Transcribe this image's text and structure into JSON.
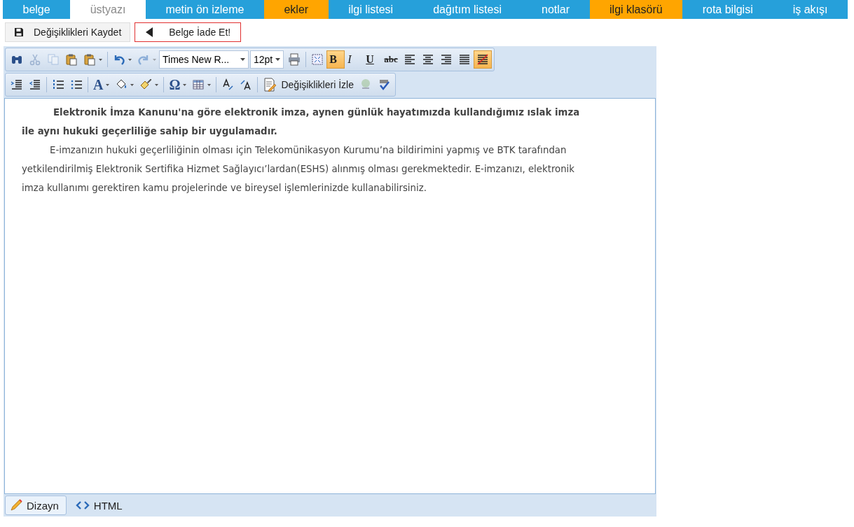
{
  "tabs": [
    {
      "label": "belge",
      "selected": false,
      "color": "#26a0da"
    },
    {
      "label": "üstyazı",
      "selected": true,
      "color": "#ffffff"
    },
    {
      "label": "metin ön izleme",
      "selected": false,
      "color": "#26a0da"
    },
    {
      "label": "ekler",
      "selected": false,
      "color": "#ffa500"
    },
    {
      "label": "ilgi listesi",
      "selected": false,
      "color": "#26a0da"
    },
    {
      "label": "dağıtım listesi",
      "selected": false,
      "color": "#26a0da"
    },
    {
      "label": "notlar",
      "selected": false,
      "color": "#26a0da"
    },
    {
      "label": "ilgi klasörü",
      "selected": false,
      "color": "#ffa500"
    },
    {
      "label": "rota bilgisi",
      "selected": false,
      "color": "#26a0da"
    },
    {
      "label": "iş akışı",
      "selected": false,
      "color": "#26a0da"
    }
  ],
  "actions": [
    {
      "kind": "save",
      "label": "Değişiklikleri Kaydet",
      "highlighted": false
    },
    {
      "kind": "back",
      "label": "Belge İade Et!",
      "highlighted": true
    }
  ],
  "toolbar_rows": [
    [
      {
        "kind": "find",
        "disabled": false
      },
      {
        "kind": "cut",
        "disabled": true
      },
      {
        "kind": "copy",
        "disabled": true
      },
      {
        "kind": "paste",
        "disabled": false
      },
      {
        "kind": "paste",
        "disabled": false,
        "dropdown": true
      },
      {
        "kind": "sep"
      },
      {
        "kind": "undo",
        "disabled": false,
        "dropdown": true
      },
      {
        "kind": "redo",
        "disabled": true,
        "dropdown": true
      },
      {
        "kind": "fontselect",
        "value": "Times New R..."
      },
      {
        "kind": "sizeselect",
        "value": "12pt"
      },
      {
        "kind": "print",
        "disabled": false
      },
      {
        "kind": "sep"
      },
      {
        "kind": "selectall",
        "disabled": false
      },
      {
        "kind": "bold",
        "glyph": "B",
        "active": true
      },
      {
        "kind": "italic",
        "glyph": "I",
        "active": false
      },
      {
        "kind": "underline",
        "glyph": "U",
        "active": false
      },
      {
        "kind": "strike",
        "glyph": "abc",
        "active": false
      },
      {
        "kind": "alignleft"
      },
      {
        "kind": "aligncenter"
      },
      {
        "kind": "alignright"
      },
      {
        "kind": "justify"
      },
      {
        "kind": "clearformat",
        "active": true
      }
    ],
    [
      {
        "kind": "indent",
        "disabled": false
      },
      {
        "kind": "outdent",
        "disabled": false
      },
      {
        "kind": "sep"
      },
      {
        "kind": "olist",
        "disabled": false
      },
      {
        "kind": "ulist",
        "disabled": false
      },
      {
        "kind": "sep"
      },
      {
        "kind": "fontcolor",
        "glyph": "A",
        "active": false,
        "dropdown": true
      },
      {
        "kind": "fill",
        "disabled": false,
        "dropdown": true
      },
      {
        "kind": "brush",
        "disabled": false,
        "dropdown": true
      },
      {
        "kind": "sep"
      },
      {
        "kind": "symbol",
        "glyph": "Ω",
        "active": false,
        "dropdown": true
      },
      {
        "kind": "table",
        "disabled": false,
        "dropdown": true
      },
      {
        "kind": "sep"
      },
      {
        "kind": "ltr",
        "disabled": false
      },
      {
        "kind": "rtl",
        "disabled": false
      },
      {
        "kind": "sep"
      },
      {
        "kind": "track",
        "label": "Değişiklikleri İzle"
      },
      {
        "kind": "link",
        "disabled": true
      },
      {
        "kind": "spell",
        "disabled": false
      }
    ]
  ],
  "paragraphs": [
    {
      "text": "Elektronik İmza Kanunu'na göre elektronik imza, aynen günlük hayatımızda kullandığımız ıslak imza ile aynı hukuki geçerliliğe sahip bir uygulamadır.",
      "bold": true
    },
    {
      "text": "E-imzanızın hukuki geçerliliğinin olması için Telekomünikasyon Kurumu’na bildirimini yapmış ve BTK tarafından yetkilendirilmiş Elektronik Sertifika Hizmet Sağlayıcı’lardan(ESHS) alınmış olması gerekmektedir. E-imzanızı, elektronik imza kullanımı gerektiren kamu projelerinde ve bireysel işlemlerinizde kullanabilirsiniz.",
      "bold": false
    }
  ],
  "modes": [
    {
      "kind": "design",
      "label": "Dizayn",
      "selected": true
    },
    {
      "kind": "html",
      "label": "HTML",
      "selected": false
    }
  ]
}
